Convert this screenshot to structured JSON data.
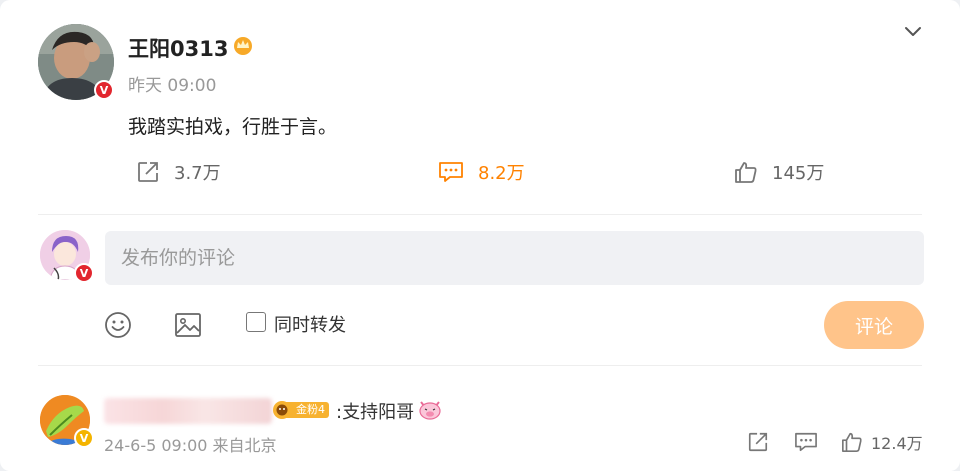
{
  "post": {
    "author_name": "王阳0313",
    "time": "昨天 09:00",
    "text": "我踏实拍戏，行胜于言。",
    "verified_badge": "V",
    "icons": [
      "crown-icon",
      "chevron-down-icon"
    ],
    "actions": {
      "repost_count": "3.7万",
      "comment_count": "8.2万",
      "like_count": "145万"
    }
  },
  "composer": {
    "placeholder": "发布你的评论",
    "repost_label": "同时转发",
    "repost_checked": false,
    "submit_label": "评论",
    "icons": [
      "emoji-icon",
      "image-icon"
    ]
  },
  "comments": [
    {
      "fan_badge": "金粉4",
      "text": ":支持阳哥",
      "meta": "24-6-5 09:00 来自北京",
      "like_count": "12.4万",
      "icons": [
        "pig-emoji-icon",
        "share-icon",
        "comment-icon",
        "like-icon"
      ]
    }
  ],
  "colors": {
    "accent": "#ff8200",
    "submit_disabled": "#ffc48a",
    "verified_red": "#e2262e",
    "verified_gold": "#f4b400",
    "fan_badge": "#f7b230"
  }
}
